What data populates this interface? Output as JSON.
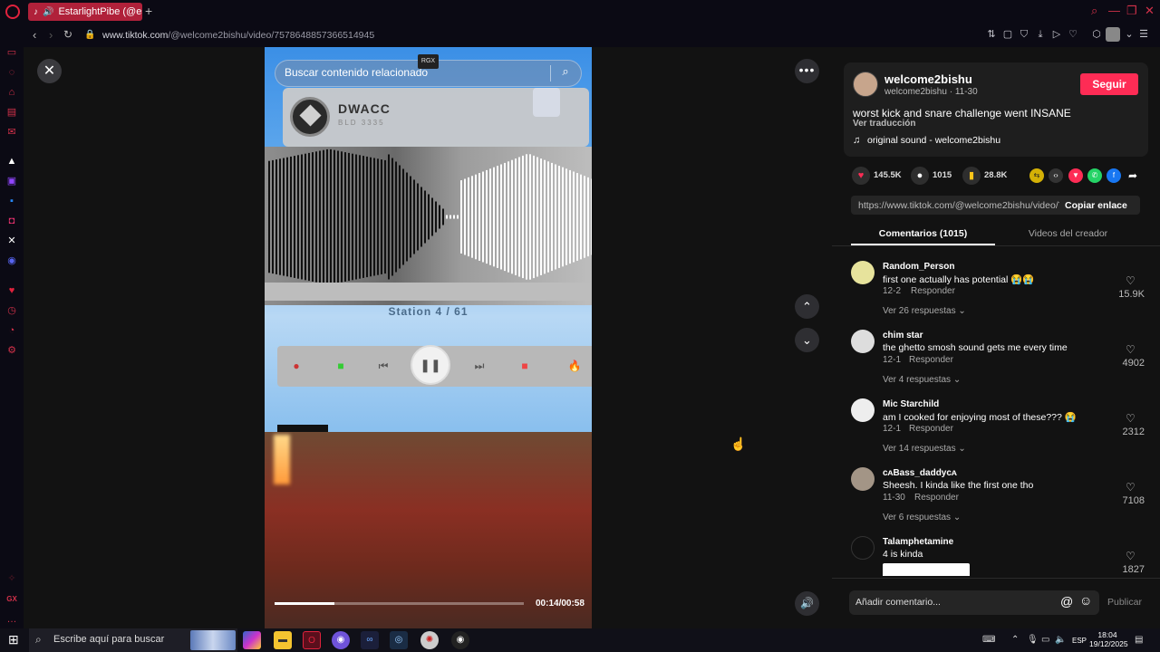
{
  "browser": {
    "tab_title": "EstarlightPibe (@estar",
    "new_tab": "+",
    "url_host": "www.tiktok.com",
    "url_path": "/@welcome2bishu/video/7578648857366514945",
    "accent": "#e0223d"
  },
  "player": {
    "search_placeholder": "Buscar contenido relacionado",
    "rgx_badge": "RGX",
    "dwacc_name": "DWACC",
    "dwacc_sub": "BLD 3335",
    "station": "Station 4 / 61",
    "time": "00:14/00:58",
    "progress": 0.24
  },
  "post": {
    "author": "welcome2bishu",
    "author_sub": "welcome2bishu · 11-30",
    "follow": "Seguir",
    "caption": "worst kick and snare challenge went INSANE",
    "translate": "Ver traducción",
    "sound": "original sound - welcome2bishu",
    "likes": "145.5K",
    "comments": "1015",
    "saves": "28.8K",
    "link": "https://www.tiktok.com/@welcome2bishu/video/7...",
    "copy_link": "Copiar enlace",
    "brand_color": "#fe2c55"
  },
  "tabs": {
    "comments": "Comentarios (1015)",
    "creator": "Videos del creador"
  },
  "comments": [
    {
      "user": "Random_Person",
      "text": "first one actually has potential 😭😭",
      "date": "12-2",
      "reply": "Responder",
      "more": "Ver 26 respuestas ⌄",
      "likes": "15.9K"
    },
    {
      "user": "chim star",
      "text": "the ghetto smosh sound gets me every time",
      "date": "12-1",
      "reply": "Responder",
      "more": "Ver 4 respuestas ⌄",
      "likes": "4902"
    },
    {
      "user": "Mic Starchild",
      "text": "am I cooked for enjoying most of these??? 😭",
      "date": "12-1",
      "reply": "Responder",
      "more": "Ver 14 respuestas ⌄",
      "likes": "2312"
    },
    {
      "user": "ᴄᴀBass_daddyᴄᴀ",
      "text": "Sheesh. I kinda like the first one tho",
      "date": "11-30",
      "reply": "Responder",
      "more": "Ver 6 respuestas ⌄",
      "likes": "7108"
    },
    {
      "user": "Talamphetamine",
      "text": "4 is kinda",
      "date": "",
      "reply": "",
      "more": "",
      "likes": "1827"
    }
  ],
  "composer": {
    "placeholder": "Añadir comentario...",
    "post": "Publicar"
  },
  "taskbar": {
    "search": "Escribe aquí para buscar",
    "lang": "ESP",
    "time": "18:04",
    "date": "19/12/2025"
  }
}
